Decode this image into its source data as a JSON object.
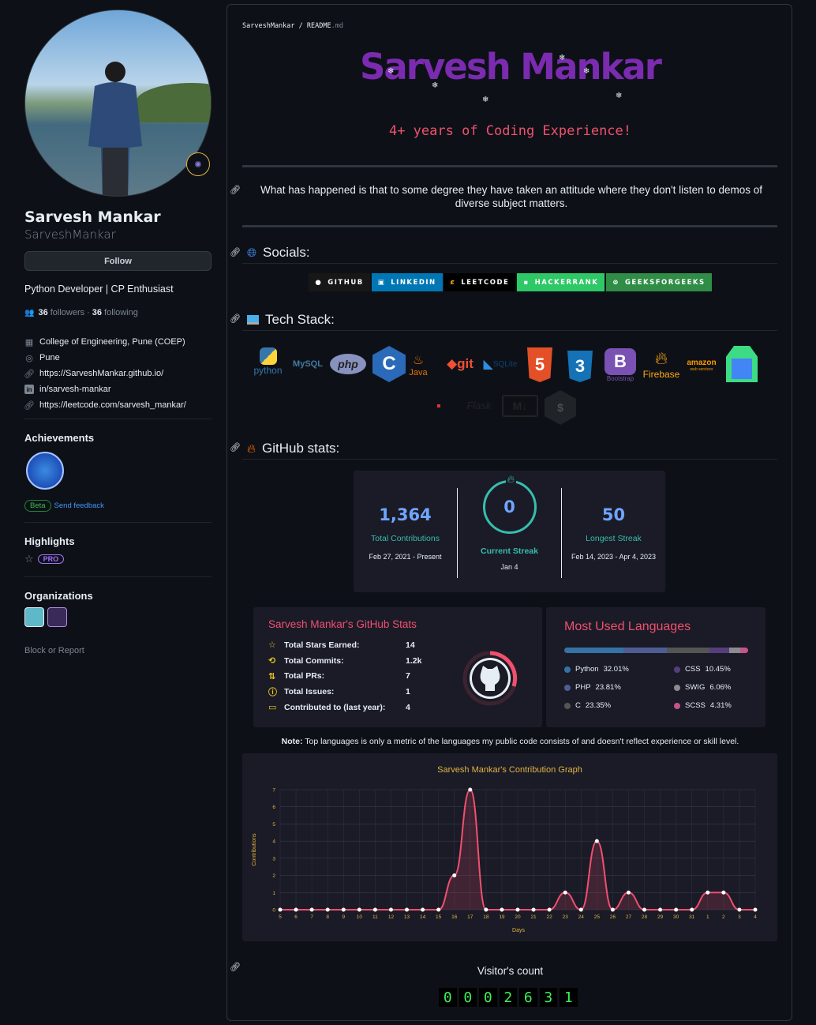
{
  "profile": {
    "full_name": "Sarvesh Mankar",
    "username": "SarveshMankar",
    "follow_label": "Follow",
    "bio": "Python Developer | CP Enthusiast",
    "followers_count": "36",
    "followers_label": "followers",
    "following_count": "36",
    "following_label": "following",
    "details": [
      {
        "icon": "organization-icon",
        "text": "College of Engineering, Pune (COEP)"
      },
      {
        "icon": "location-icon",
        "text": "Pune"
      },
      {
        "icon": "link-icon",
        "text": "https://SarveshMankar.github.io/"
      },
      {
        "icon": "linkedin-icon",
        "text": "in/sarvesh-mankar"
      },
      {
        "icon": "link-icon",
        "text": "https://leetcode.com/sarvesh_mankar/"
      }
    ],
    "achievements_title": "Achievements",
    "beta_label": "Beta",
    "feedback_label": "Send feedback",
    "highlights_title": "Highlights",
    "pro_label": "PRO",
    "organizations_title": "Organizations",
    "block_label": "Block or Report"
  },
  "readme": {
    "breadcrumb_user": "SarveshMankar",
    "breadcrumb_sep": "/",
    "breadcrumb_file": "README",
    "breadcrumb_ext": ".md",
    "title": "Sarvesh Mankar",
    "typed_text": "4+ years of Coding Experience!",
    "quote": "What has happened is that to some degree they have taken an attitude where they don't listen to demos of diverse subject matters.",
    "socials_heading": "Socials:",
    "socials": [
      {
        "label": "GITHUB",
        "color": "#181717"
      },
      {
        "label": "LINKEDIN",
        "color": "#0077b5"
      },
      {
        "label": "LEETCODE",
        "color": "#000000"
      },
      {
        "label": "HACKERRANK",
        "color": "#2ec866"
      },
      {
        "label": "GEEKSFORGEEKS",
        "color": "#2f8d46"
      }
    ],
    "tech_heading": "Tech Stack:",
    "tech": {
      "python": "python",
      "mysql": "MySQL",
      "php": "php",
      "c": "C",
      "java": "Java",
      "git": "git",
      "sqlite": "SQLite",
      "html5": "5",
      "css3": "3",
      "bootstrap": "Bootstrap",
      "bootstrap_letter": "B",
      "firebase": "Firebase",
      "aws": "amazon",
      "aws_sub": "web services",
      "flask": "Flask",
      "markdown": "M↓"
    },
    "stats_heading": "GitHub stats:",
    "visitor_heading": "Visitor's count",
    "visitor_digits": [
      "0",
      "0",
      "0",
      "2",
      "6",
      "3",
      "1"
    ],
    "note_bold": "Note:",
    "note_text": " Top languages is only a metric of the languages my public code consists of and doesn't reflect experience or skill level."
  },
  "streak": {
    "total": "1,364",
    "total_label": "Total Contributions",
    "total_range": "Feb 27, 2021 - Present",
    "current": "0",
    "current_label": "Current Streak",
    "current_range": "Jan 4",
    "longest": "50",
    "longest_label": "Longest Streak",
    "longest_range": "Feb 14, 2023 - Apr 4, 2023"
  },
  "stats": {
    "title": "Sarvesh Mankar's GitHub Stats",
    "rows": [
      {
        "icon": "star-icon",
        "glyph": "☆",
        "label": "Total Stars Earned:",
        "value": "14"
      },
      {
        "icon": "history-icon",
        "glyph": "⟲",
        "label": "Total Commits:",
        "value": "1.2k"
      },
      {
        "icon": "pull-request-icon",
        "glyph": "⇅",
        "label": "Total PRs:",
        "value": "7"
      },
      {
        "icon": "issue-icon",
        "glyph": "ⓘ",
        "label": "Total Issues:",
        "value": "1"
      },
      {
        "icon": "repo-icon",
        "glyph": "▭",
        "label": "Contributed to (last year):",
        "value": "4"
      }
    ]
  },
  "languages": {
    "title": "Most Used Languages",
    "items": [
      {
        "name": "Python",
        "pct": "32.01%",
        "value": 32.01,
        "color": "#3572A5"
      },
      {
        "name": "PHP",
        "pct": "23.81%",
        "value": 23.81,
        "color": "#4F5D95"
      },
      {
        "name": "C",
        "pct": "23.35%",
        "value": 23.35,
        "color": "#555555"
      },
      {
        "name": "CSS",
        "pct": "10.45%",
        "value": 10.45,
        "color": "#563d7c"
      },
      {
        "name": "SWIG",
        "pct": "6.06%",
        "value": 6.06,
        "color": "#8c8c8c"
      },
      {
        "name": "SCSS",
        "pct": "4.31%",
        "value": 4.31,
        "color": "#c6538c"
      }
    ]
  },
  "chart_data": {
    "type": "line",
    "title": "Sarvesh Mankar's Contribution Graph",
    "xlabel": "Days",
    "ylabel": "Contributions",
    "x": [
      "5",
      "6",
      "7",
      "8",
      "9",
      "10",
      "11",
      "12",
      "13",
      "14",
      "15",
      "16",
      "17",
      "18",
      "19",
      "20",
      "21",
      "22",
      "23",
      "24",
      "25",
      "26",
      "27",
      "28",
      "29",
      "30",
      "31",
      "1",
      "2",
      "3",
      "4"
    ],
    "values": [
      0,
      0,
      0,
      0,
      0,
      0,
      0,
      0,
      0,
      0,
      0,
      2,
      7,
      0,
      0,
      0,
      0,
      0,
      1,
      0,
      4,
      0,
      1,
      0,
      0,
      0,
      0,
      1,
      1,
      0,
      0
    ],
    "yticks": [
      0,
      1,
      2,
      3,
      4,
      5,
      6,
      7
    ],
    "ylim": [
      0,
      7
    ],
    "grid": true,
    "line_color": "#f0506e",
    "title_color": "#e3b341"
  }
}
